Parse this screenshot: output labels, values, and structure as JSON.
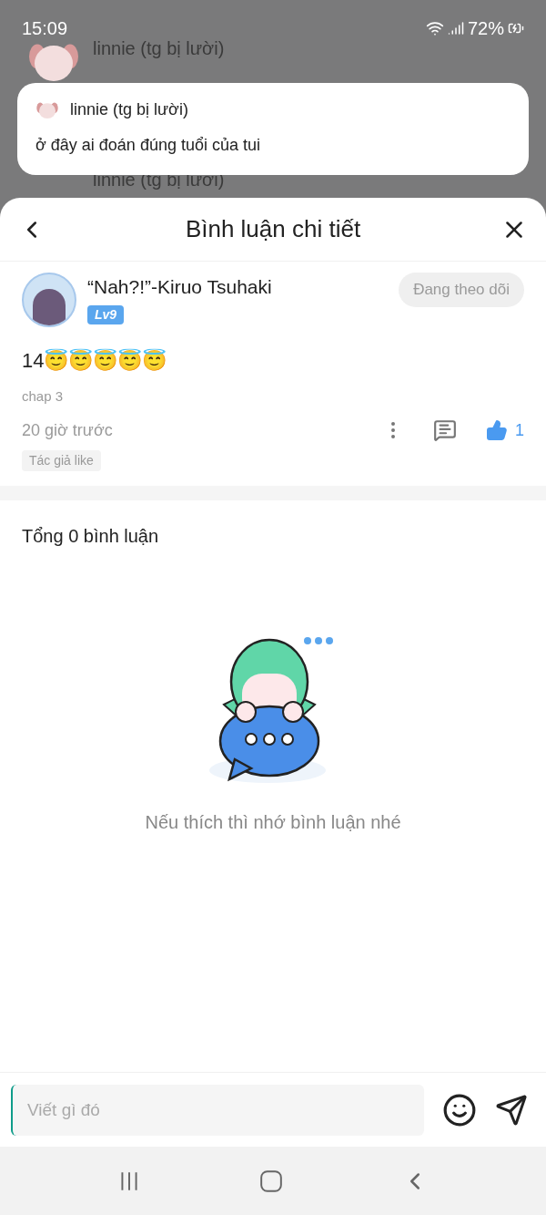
{
  "status_bar": {
    "time": "15:09",
    "battery": "72%"
  },
  "background_messages": [
    {
      "sender": "linnie (tg bị lười)"
    },
    {
      "sender": "linnie (tg bị lười)"
    }
  ],
  "notification": {
    "sender": "linnie (tg bị lười)",
    "message": "ở đây ai đoán đúng tuổi của tui"
  },
  "sheet": {
    "title": "Bình luận chi tiết"
  },
  "comment": {
    "author": "“Nah?!”-Kiruo Tsuhaki",
    "level": "Lv9",
    "follow_button": "Đang theo dõi",
    "text": "14😇😇😇😇😇",
    "chapter": "chap 3",
    "time": "20 giờ trước",
    "likes": "1",
    "liked": true,
    "tag": "Tác giả like"
  },
  "replies": {
    "total": "Tổng 0 bình luận",
    "empty_message": "Nếu thích thì nhớ bình luận nhé"
  },
  "input": {
    "placeholder": "Viết gì đó"
  }
}
